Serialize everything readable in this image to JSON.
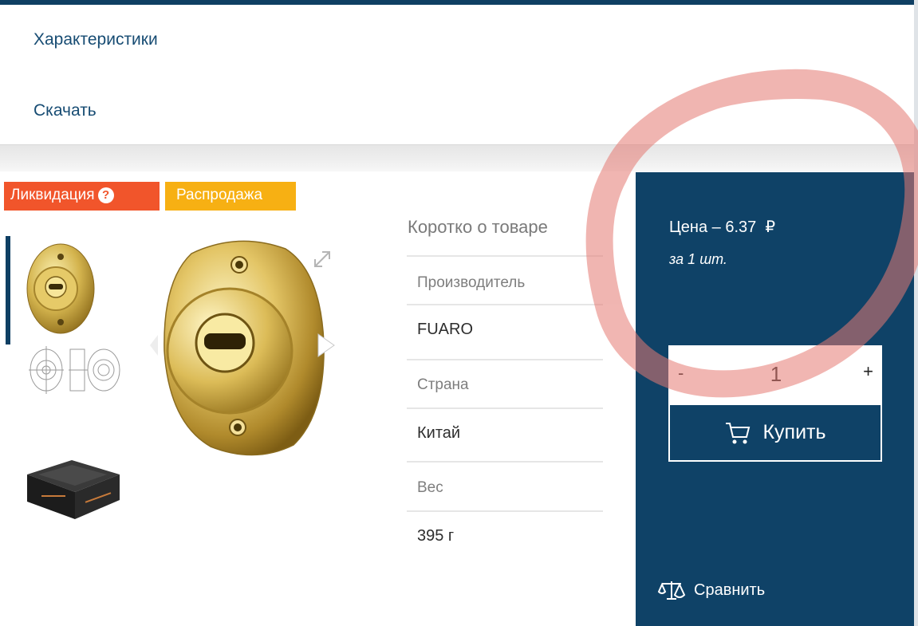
{
  "nav": {
    "specs_label": "Характеристики",
    "download_label": "Скачать"
  },
  "badges": {
    "liquidation": "Ликвидация",
    "liquidation_help": "?",
    "sale": "Распродажа"
  },
  "colors": {
    "header_blue": "#0f3f63",
    "link_blue": "#174c73",
    "badge_red": "#f1552b",
    "badge_orange": "#f7b013",
    "panel_blue": "#0f4267",
    "annotation_red": "#e57a73"
  },
  "specs": {
    "title": "Коротко о товаре",
    "items": [
      {
        "label": "Производитель",
        "value": "FUARO"
      },
      {
        "label": "Страна",
        "value": "Китай"
      },
      {
        "label": "Вес",
        "value": "395 г"
      }
    ]
  },
  "buy": {
    "price_text": "Цена – 6.37",
    "currency": "₽",
    "per_unit": "за 1 шт.",
    "qty_minus": "-",
    "qty_value": "1",
    "qty_plus": "+",
    "buy_label": "Купить",
    "compare_label": "Сравнить"
  },
  "icons": {
    "expand": "expand-icon",
    "cart": "cart-icon",
    "compare": "scales-icon",
    "help": "question-circle-icon"
  }
}
